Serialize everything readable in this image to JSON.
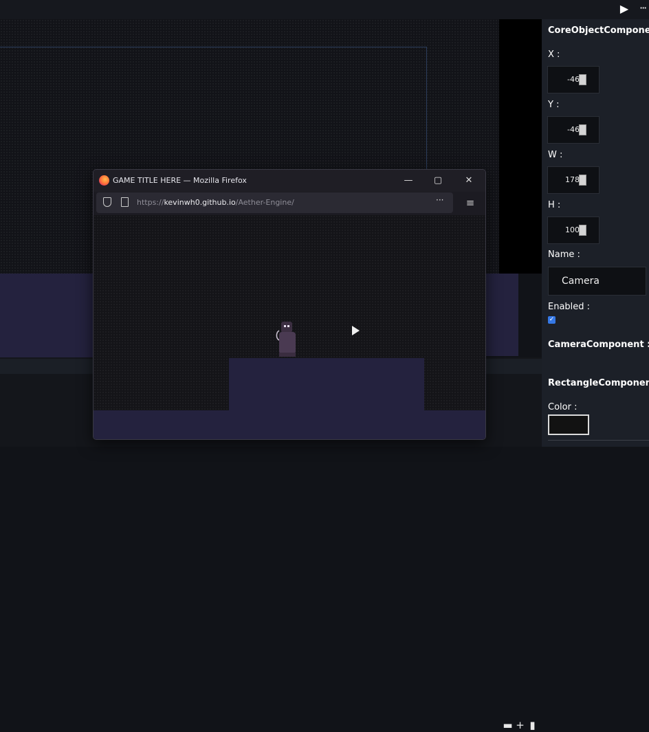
{
  "toolbar": {
    "play_icon": "play-icon",
    "play_glyph": "▶",
    "more_glyph": "···"
  },
  "asset_toolbar": {
    "icons": [
      "folder-icon",
      "plus-icon",
      "file-icon"
    ],
    "folder_glyph": "▬",
    "add_glyph": "+",
    "file_glyph": "▮"
  },
  "inspector": {
    "core_header": "CoreObjectCompone",
    "x_label": "X :",
    "x_value": "-46",
    "y_label": "Y :",
    "y_value": "-46",
    "w_label": "W :",
    "w_value": "178",
    "h_label": "H :",
    "h_value": "100",
    "name_label": "Name :",
    "name_value": "Camera",
    "enabled_label": "Enabled :",
    "enabled_checked": true,
    "enabled_glyph": "✓",
    "camera_header": "CameraComponent :",
    "rect_header": "RectangleComponen",
    "color_label": "Color :",
    "color_value": "#121212"
  },
  "firefox": {
    "title": "GAME TITLE HERE — Mozilla Firefox",
    "minimize_glyph": "—",
    "maximize_glyph": "▢",
    "close_glyph": "✕",
    "url_prefix": "https://",
    "url_domain": "kevinwh0.github.io",
    "url_path": "/Aether-Engine/",
    "url_more_glyph": "···",
    "menu_glyph": "≡"
  }
}
